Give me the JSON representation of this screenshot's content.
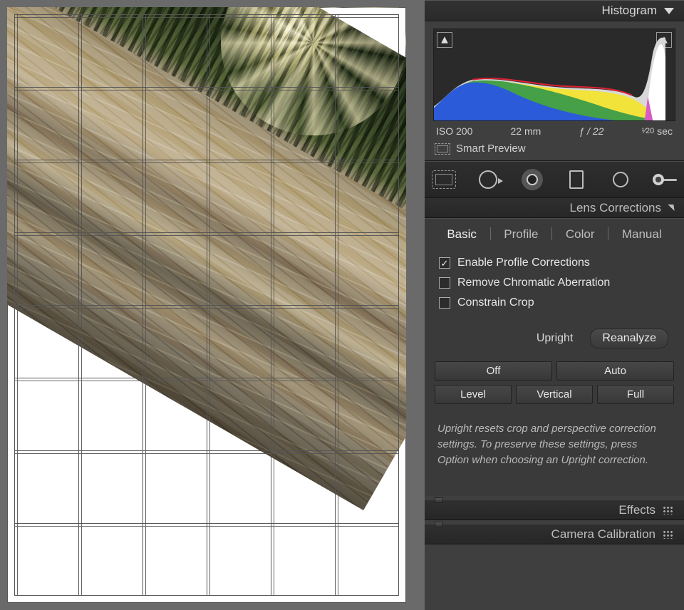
{
  "histogram": {
    "title": "Histogram"
  },
  "exif": {
    "iso": "ISO 200",
    "focal": "22 mm",
    "aperture": "ƒ / 22",
    "shutter_pre": "¹⁄",
    "shutter_num": "20",
    "shutter_suf": " sec"
  },
  "smart_preview": {
    "label": "Smart Preview"
  },
  "panels": {
    "lens_corrections": {
      "title": "Lens Corrections"
    },
    "effects": {
      "title": "Effects"
    },
    "camera_calibration": {
      "title": "Camera Calibration"
    }
  },
  "lens": {
    "tabs": {
      "basic": "Basic",
      "profile": "Profile",
      "color": "Color",
      "manual": "Manual",
      "active": "basic"
    },
    "checks": {
      "enable_profile": {
        "label": "Enable Profile Corrections",
        "checked": true
      },
      "remove_ca": {
        "label": "Remove Chromatic Aberration",
        "checked": false
      },
      "constrain": {
        "label": "Constrain Crop",
        "checked": false
      }
    },
    "upright_label": "Upright",
    "reanalyze": "Reanalyze",
    "buttons": {
      "off": "Off",
      "auto": "Auto",
      "level": "Level",
      "vertical": "Vertical",
      "full": "Full"
    },
    "hint": "Upright resets crop and perspective correction settings. To preserve these settings, press Option when choosing an Upright correction."
  }
}
